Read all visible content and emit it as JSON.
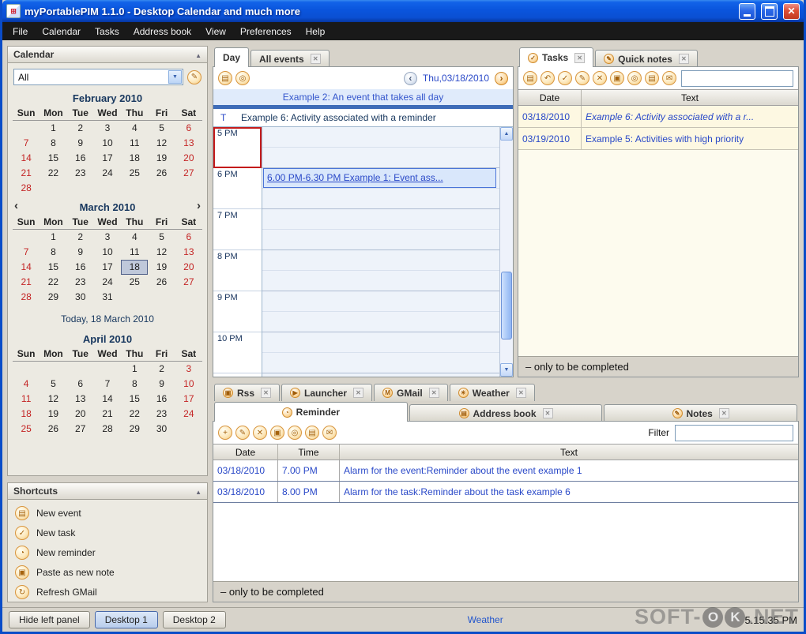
{
  "window": {
    "title": "myPortablePIM 1.1.0 - Desktop Calendar and much more"
  },
  "menu": [
    "File",
    "Calendar",
    "Tasks",
    "Address book",
    "View",
    "Preferences",
    "Help"
  ],
  "sidebar": {
    "calendar": {
      "header": "Calendar",
      "filter_value": "All",
      "today_label": "Today, 18 March 2010",
      "dow": [
        "Sun",
        "Mon",
        "Tue",
        "Wed",
        "Thu",
        "Fri",
        "Sat"
      ],
      "months": [
        {
          "title": "February 2010",
          "nav": false,
          "weeks": [
            [
              "",
              "1",
              "2",
              "3",
              "4",
              "5",
              "6"
            ],
            [
              "7",
              "8",
              "9",
              "10",
              "11",
              "12",
              "13"
            ],
            [
              "14",
              "15",
              "16",
              "17",
              "18",
              "19",
              "20"
            ],
            [
              "21",
              "22",
              "23",
              "24",
              "25",
              "26",
              "27"
            ],
            [
              "28",
              "",
              "",
              "",
              "",
              "",
              ""
            ]
          ]
        },
        {
          "title": "March 2010",
          "nav": true,
          "selected": "18",
          "weeks": [
            [
              "",
              "1",
              "2",
              "3",
              "4",
              "5",
              "6"
            ],
            [
              "7",
              "8",
              "9",
              "10",
              "11",
              "12",
              "13"
            ],
            [
              "14",
              "15",
              "16",
              "17",
              "18",
              "19",
              "20"
            ],
            [
              "21",
              "22",
              "23",
              "24",
              "25",
              "26",
              "27"
            ],
            [
              "28",
              "29",
              "30",
              "31",
              "",
              "",
              ""
            ]
          ]
        },
        {
          "title": "April 2010",
          "nav": false,
          "weeks": [
            [
              "",
              "",
              "",
              "",
              "1",
              "2",
              "3"
            ],
            [
              "4",
              "5",
              "6",
              "7",
              "8",
              "9",
              "10"
            ],
            [
              "11",
              "12",
              "13",
              "14",
              "15",
              "16",
              "17"
            ],
            [
              "18",
              "19",
              "20",
              "21",
              "22",
              "23",
              "24"
            ],
            [
              "25",
              "26",
              "27",
              "28",
              "29",
              "30",
              ""
            ]
          ]
        }
      ]
    },
    "shortcuts": {
      "header": "Shortcuts",
      "items": [
        {
          "icon": "new-event-icon",
          "glyph": "▤",
          "label": "New event"
        },
        {
          "icon": "new-task-icon",
          "glyph": "✓",
          "label": "New task"
        },
        {
          "icon": "new-reminder-icon",
          "glyph": "◔",
          "label": "New reminder"
        },
        {
          "icon": "paste-note-icon",
          "glyph": "▣",
          "label": "Paste as new note"
        },
        {
          "icon": "refresh-gmail-icon",
          "glyph": "↻",
          "label": "Refresh GMail"
        }
      ]
    }
  },
  "day_view": {
    "tabs": [
      {
        "label": "Day",
        "active": true,
        "closable": false
      },
      {
        "label": "All events",
        "active": false,
        "closable": true
      }
    ],
    "toolbar_icons": [
      {
        "name": "print-icon",
        "glyph": "▤"
      },
      {
        "name": "zoom-icon",
        "glyph": "◎"
      }
    ],
    "nav": {
      "prev": "‹",
      "date": "Thu,03/18/2010",
      "next": "›"
    },
    "allday_event": "Example 2: An event that takes all day",
    "reminder_marker": "T",
    "reminder_event": "Example 6: Activity associated with a reminder",
    "hours": [
      "5 PM",
      "6 PM",
      "7 PM",
      "8 PM",
      "9 PM",
      "10 PM"
    ],
    "current_hour": "5 PM",
    "timed_event": {
      "hour": "6 PM",
      "label": "6.00 PM-6.30 PM Example 1: Event ass..."
    }
  },
  "tasks_panel": {
    "tabs": [
      {
        "label": "Tasks",
        "icon": "tasks-icon",
        "glyph": "✓",
        "active": true,
        "closable": true
      },
      {
        "label": "Quick notes",
        "icon": "quick-notes-icon",
        "glyph": "✎",
        "active": false,
        "closable": true
      }
    ],
    "toolbar_icons": [
      {
        "name": "new-task-icon",
        "glyph": "▤"
      },
      {
        "name": "undo-icon",
        "glyph": "↶"
      },
      {
        "name": "complete-icon",
        "glyph": "✓"
      },
      {
        "name": "edit-icon",
        "glyph": "✎"
      },
      {
        "name": "delete-icon",
        "glyph": "✕"
      },
      {
        "name": "copy-icon",
        "glyph": "▣"
      },
      {
        "name": "zoom-icon",
        "glyph": "◎"
      },
      {
        "name": "print-icon",
        "glyph": "▤"
      },
      {
        "name": "mail-icon",
        "glyph": "✉"
      }
    ],
    "columns": [
      "Date",
      "Text"
    ],
    "rows": [
      {
        "date": "03/18/2010",
        "text": "Example 6: Activity associated with a r...",
        "italic": true
      },
      {
        "date": "03/19/2010",
        "text": "Example 5: Activities with high priority",
        "italic": false
      }
    ],
    "footer_note": "– only to be completed"
  },
  "bottom_panel": {
    "small_tabs": [
      {
        "label": "Rss",
        "icon": "rss-icon",
        "glyph": "▣",
        "closable": true
      },
      {
        "label": "Launcher",
        "icon": "launcher-icon",
        "glyph": "▶",
        "closable": true
      },
      {
        "label": "GMail",
        "icon": "gmail-icon",
        "glyph": "M",
        "closable": true
      },
      {
        "label": "Weather",
        "icon": "weather-icon",
        "glyph": "☀",
        "closable": true
      }
    ],
    "big_tabs": [
      {
        "label": "Reminder",
        "icon": "reminder-icon",
        "glyph": "◔",
        "active": true,
        "closable": false
      },
      {
        "label": "Address book",
        "icon": "address-book-icon",
        "glyph": "▤",
        "closable": true
      },
      {
        "label": "Notes",
        "icon": "notes-icon",
        "glyph": "✎",
        "closable": true
      }
    ],
    "toolbar_icons": [
      {
        "name": "add-icon",
        "glyph": "+"
      },
      {
        "name": "edit-icon",
        "glyph": "✎"
      },
      {
        "name": "delete-icon",
        "glyph": "✕"
      },
      {
        "name": "copy-icon",
        "glyph": "▣"
      },
      {
        "name": "zoom-icon",
        "glyph": "◎"
      },
      {
        "name": "print-icon",
        "glyph": "▤"
      },
      {
        "name": "mail-icon",
        "glyph": "✉"
      }
    ],
    "filter_label": "Filter",
    "columns": [
      "Date",
      "Time",
      "Text"
    ],
    "rows": [
      {
        "date": "03/18/2010",
        "time": "7.00 PM",
        "text": "Alarm for the event:Reminder about the event example 1"
      },
      {
        "date": "03/18/2010",
        "time": "8.00 PM",
        "text": "Alarm for the task:Reminder about the task example 6"
      }
    ],
    "footer_note": "– only to be completed"
  },
  "status_bar": {
    "hide_left_panel": "Hide left panel",
    "desktops": [
      {
        "label": "Desktop 1",
        "active": true
      },
      {
        "label": "Desktop 2",
        "active": false
      }
    ],
    "weather_link": "Weather",
    "time": "5.15.35 PM"
  },
  "watermark": {
    "prefix": "SOFT-",
    "circled": [
      "O",
      "K"
    ],
    "suffix": ".NET"
  }
}
